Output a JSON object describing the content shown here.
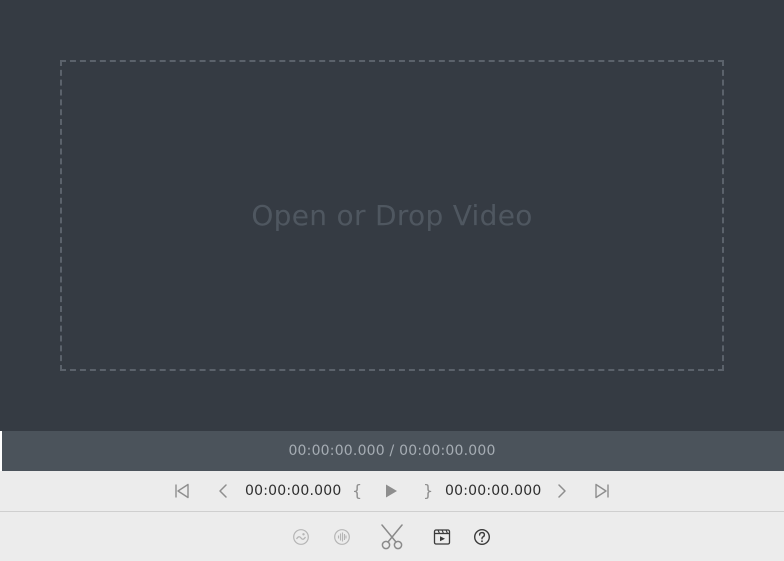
{
  "dropzone": {
    "text": "Open or Drop Video"
  },
  "timebar": {
    "text": "00:00:00.000 / 00:00:00.000"
  },
  "controls": {
    "start_time": "00:00:00.000",
    "end_time": "00:00:00.000",
    "open_brace": "{",
    "close_brace": "}",
    "icons": [
      "skip-to-start-icon",
      "previous-frame-icon",
      "play-icon",
      "next-frame-icon",
      "skip-to-end-icon"
    ]
  },
  "tools": {
    "icons": [
      "video-filter-icon",
      "audio-icon",
      "scissors-icon",
      "media-info-icon",
      "help-icon"
    ]
  },
  "colors": {
    "preview_bg": "#353b43",
    "timebar_bg": "#4b535b",
    "controls_bg": "#ececec",
    "dropzone_border": "#5b626b",
    "dropzone_text": "#4f5760"
  }
}
